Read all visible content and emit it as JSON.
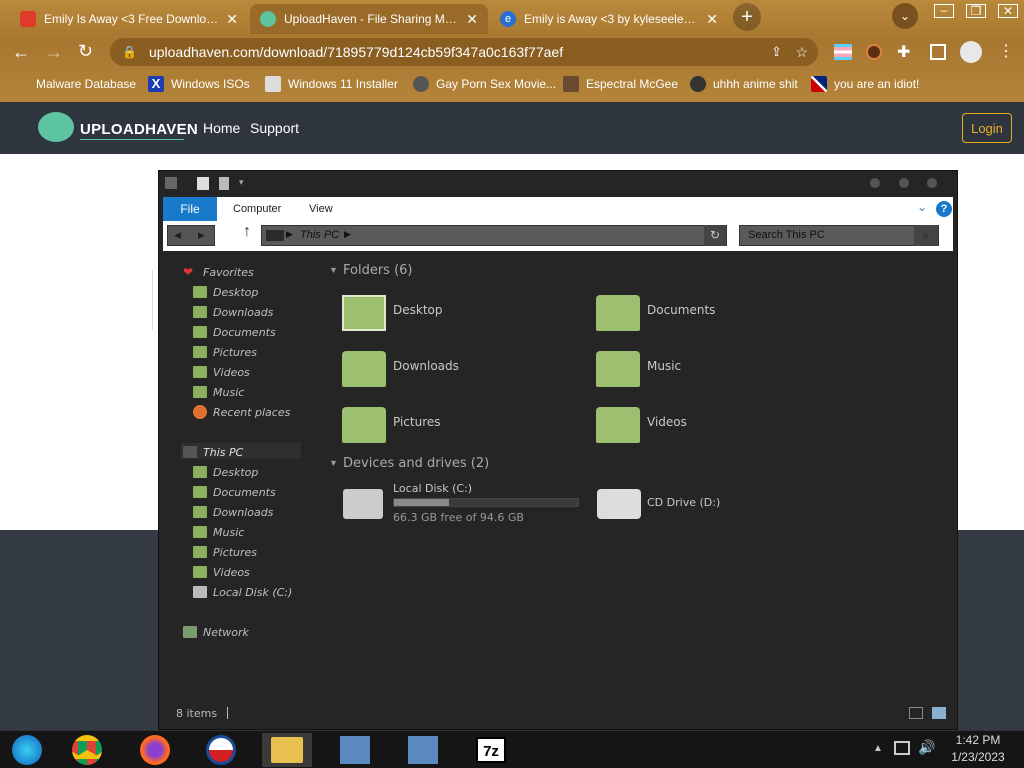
{
  "tabs": [
    {
      "title": "Emily Is Away <3 Free Download",
      "close": "✕"
    },
    {
      "title": "UploadHaven - File Sharing Made",
      "close": "✕"
    },
    {
      "title": "Emily is Away <3 by kyleseeley23",
      "close": "✕"
    }
  ],
  "toolbar": {
    "url": "uploadhaven.com/download/71895779d124cb59f347a0c163f77aef"
  },
  "bookmarks": [
    "Malware Database",
    "Windows ISOs",
    "Windows 11 Installer",
    "Gay Porn Sex Movie...",
    "Espectral McGee",
    "uhhh anime shit",
    "you are an idiot!"
  ],
  "site": {
    "logo": "UPLOADHAVEN",
    "nav": [
      "Home",
      "Support"
    ],
    "login": "Login"
  },
  "explorer": {
    "ribbon_tabs": [
      "File",
      "Computer",
      "View"
    ],
    "path": "This PC",
    "search_placeholder": "Search This PC",
    "nav": {
      "favorites": "Favorites",
      "fav_items": [
        "Desktop",
        "Downloads",
        "Documents",
        "Pictures",
        "Videos",
        "Music",
        "Recent places"
      ],
      "thispc": "This PC",
      "pc_items": [
        "Desktop",
        "Documents",
        "Downloads",
        "Music",
        "Pictures",
        "Videos",
        "Local Disk (C:)"
      ],
      "network": "Network"
    },
    "folders_header": "Folders (6)",
    "folders": [
      "Desktop",
      "Documents",
      "Downloads",
      "Music",
      "Pictures",
      "Videos"
    ],
    "devices_header": "Devices and drives (2)",
    "drive_c": {
      "name": "Local Disk (C:)",
      "free": "66.3 GB free of 94.6 GB",
      "used_fraction": 0.3
    },
    "drive_d": {
      "name": "CD Drive (D:)"
    },
    "status": "8 items"
  },
  "taskbar": {
    "time": "1:42 PM",
    "date": "1/23/2023",
    "app_7z": "7z"
  }
}
